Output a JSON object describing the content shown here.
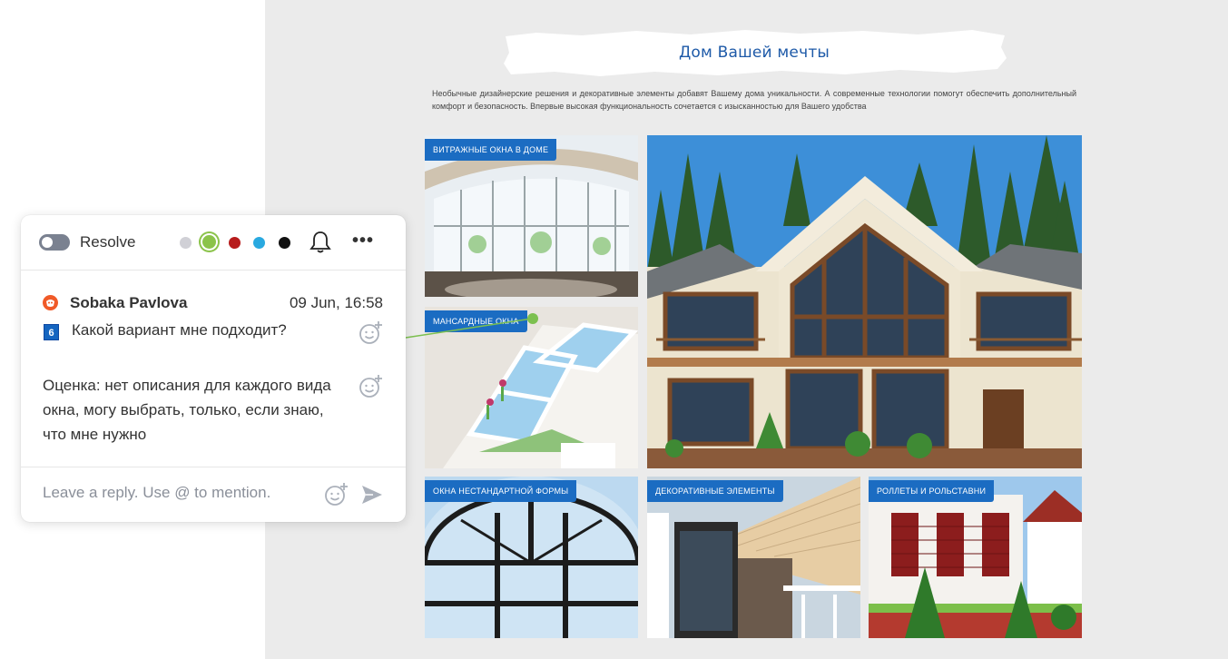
{
  "page": {
    "title": "Дом Вашей мечты",
    "subtitle": "Необычные дизайнерские решения и декоративные элементы добавят Вашему дома уникальности. А современные технологии помогут обеспечить дополнительный комфорт и безопасность. Впервые высокая функциональность сочетается с изысканностью для Вашего удобства",
    "tiles": [
      {
        "label": "ВИТРАЖНЫЕ ОКНА В ДОМЕ"
      },
      {
        "label": "МАНСАРДНЫЕ ОКНА"
      },
      {
        "label": "ОКНА НЕСТАНДАРТНОЙ ФОРМЫ"
      },
      {
        "label": "ДЕКОРАТИВНЫЕ ЭЛЕМЕНТЫ"
      },
      {
        "label": "РОЛЛЕТЫ И РОЛЬСТАВНИ"
      }
    ]
  },
  "comment_card": {
    "resolve_label": "Resolve",
    "resolve_on": false,
    "color_options": [
      "#d0d0d6",
      "#8bc34a",
      "#b71c1c",
      "#29a9e0",
      "#111111"
    ],
    "selected_color": "#8bc34a",
    "bell_icon": "bell-icon",
    "more_icon": "more-horizontal-icon",
    "author": "Sobaka Pavlova",
    "timestamp": "09 Jun, 16:58",
    "badge_number": "6",
    "comment": "Какой вариант мне подходит?",
    "note": "Оценка: нет описания для каждого вида окна, могу выбрать, только, если знаю, что мне нужно",
    "reply_placeholder": "Leave a reply. Use @ to mention.",
    "emoji_icon": "emoji-add-icon",
    "send_icon": "send-icon"
  }
}
